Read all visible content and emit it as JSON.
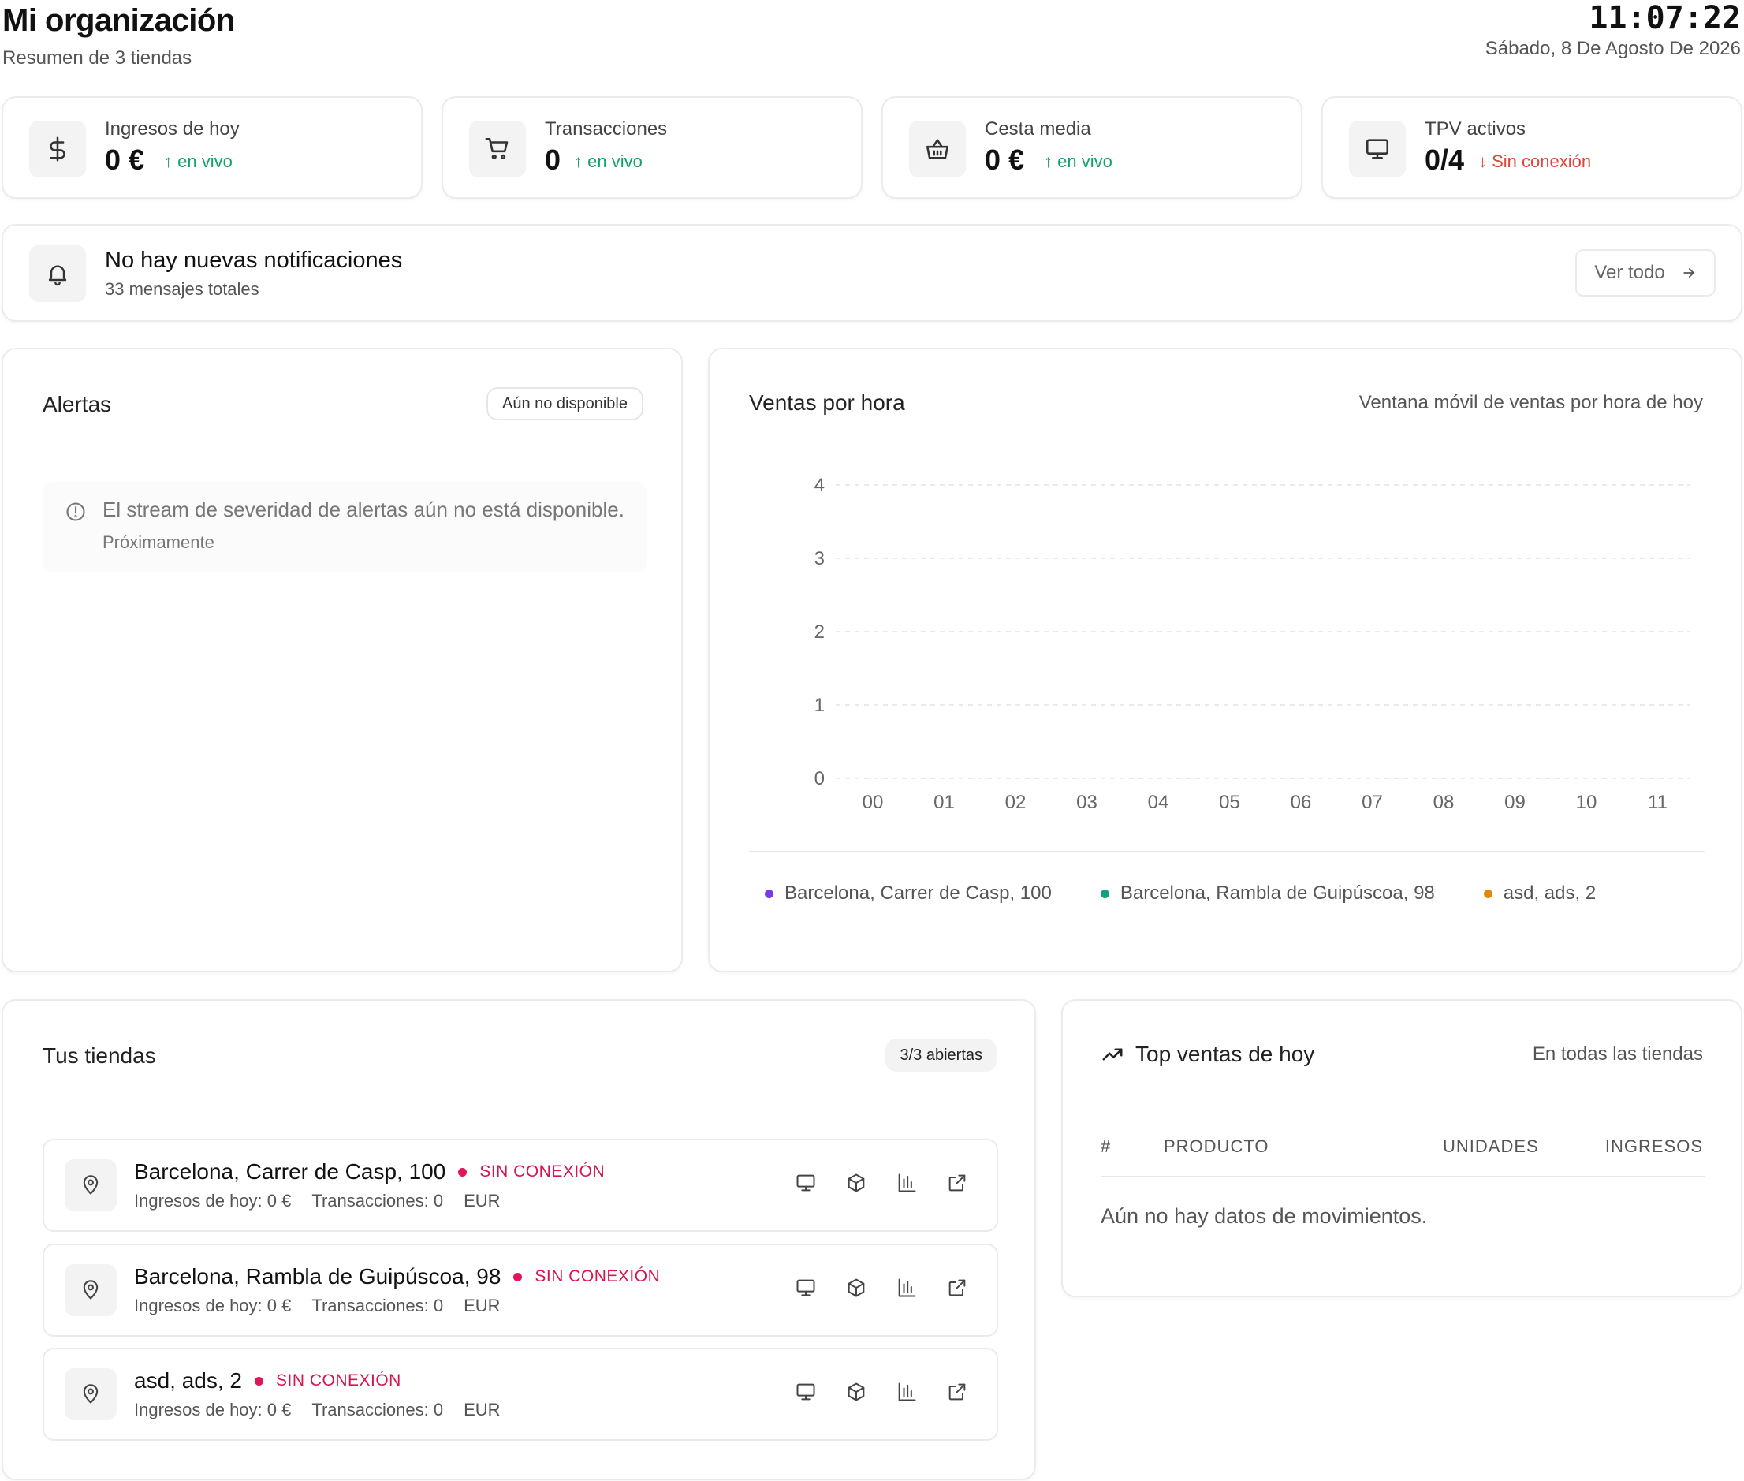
{
  "header": {
    "title": "Mi organización",
    "subtitle": "Resumen de 3 tiendas",
    "time": "11:07:22",
    "date": "Sábado, 8 De Agosto De 2026"
  },
  "stats": [
    {
      "label": "Ingresos de hoy",
      "value": "0 €",
      "trend": "en vivo",
      "trend_dir": "up",
      "icon": "dollar-icon"
    },
    {
      "label": "Transacciones",
      "value": "0",
      "trend": "en vivo",
      "trend_dir": "up",
      "icon": "cart-icon"
    },
    {
      "label": "Cesta media",
      "value": "0 €",
      "trend": "en vivo",
      "trend_dir": "up",
      "icon": "basket-icon"
    },
    {
      "label": "TPV activos",
      "value": "0/4",
      "trend": "Sin conexión",
      "trend_dir": "down",
      "icon": "monitor-icon"
    }
  ],
  "notifications": {
    "title": "No hay nuevas notificaciones",
    "subtitle": "33 mensajes totales",
    "button": "Ver todo"
  },
  "alerts": {
    "title": "Alertas",
    "badge": "Aún no disponible",
    "info": "El stream de severidad de alertas aún no está disponible.",
    "info_sub": "Próximamente"
  },
  "sales_chart": {
    "title": "Ventas por hora",
    "subtitle": "Ventana móvil de ventas por hora de hoy"
  },
  "chart_data": {
    "type": "line",
    "x": [
      "00",
      "01",
      "02",
      "03",
      "04",
      "05",
      "06",
      "07",
      "08",
      "09",
      "10",
      "11"
    ],
    "yticks": [
      0,
      1,
      2,
      3,
      4
    ],
    "ylim": [
      0,
      4
    ],
    "grid": true,
    "legend": "bottom",
    "series": [
      {
        "name": "Barcelona, Carrer de Casp, 100",
        "color": "#7c3aed",
        "values": [
          0,
          0,
          0,
          0,
          0,
          0,
          0,
          0,
          0,
          0,
          0,
          0
        ]
      },
      {
        "name": "Barcelona, Rambla de Guipúscoa, 98",
        "color": "#10a37f",
        "values": [
          0,
          0,
          0,
          0,
          0,
          0,
          0,
          0,
          0,
          0,
          0,
          0
        ]
      },
      {
        "name": "asd, ads, 2",
        "color": "#e08a0b",
        "values": [
          0,
          0,
          0,
          0,
          0,
          0,
          0,
          0,
          0,
          0,
          0,
          0
        ]
      }
    ]
  },
  "stores": {
    "title": "Tus tiendas",
    "badge": "3/3 abiertas",
    "items": [
      {
        "name": "Barcelona, Carrer de Casp, 100",
        "status": "SIN CONEXIÓN",
        "revenue": "Ingresos de hoy: 0 €",
        "transactions": "Transacciones: 0",
        "currency": "EUR"
      },
      {
        "name": "Barcelona, Rambla de Guipúscoa, 98",
        "status": "SIN CONEXIÓN",
        "revenue": "Ingresos de hoy: 0 €",
        "transactions": "Transacciones: 0",
        "currency": "EUR"
      },
      {
        "name": "asd, ads, 2",
        "status": "SIN CONEXIÓN",
        "revenue": "Ingresos de hoy: 0 €",
        "transactions": "Transacciones: 0",
        "currency": "EUR"
      }
    ]
  },
  "top_sales": {
    "title": "Top ventas de hoy",
    "subtitle": "En todas las tiendas",
    "columns": [
      "#",
      "PRODUCTO",
      "UNIDADES",
      "INGRESOS"
    ],
    "empty": "Aún no hay datos de movimientos."
  },
  "colors": {
    "trend_up": "#12a36a",
    "trend_down": "#e0453a",
    "status_offline": "#d6154f"
  }
}
